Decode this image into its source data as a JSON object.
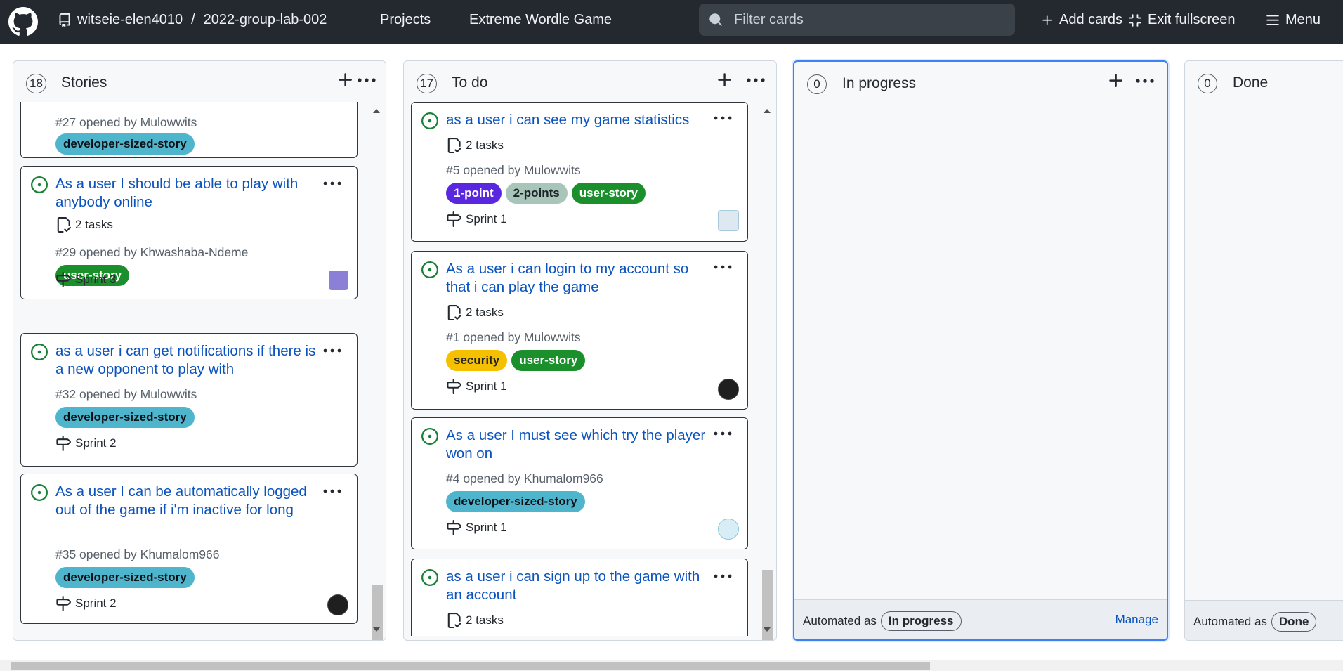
{
  "topbar": {
    "repo_owner": "witseie-elen4010",
    "repo_sep": "/",
    "repo_name": "2022-group-lab-002",
    "nav_projects": "Projects",
    "nav_project_name": "Extreme Wordle Game",
    "search_placeholder": "Filter cards",
    "add_cards": "Add cards",
    "exit_fullscreen": "Exit fullscreen",
    "menu": "Menu"
  },
  "colors": {
    "topbar_bg": "#24292f",
    "link_blue": "#0a53be",
    "open_green": "#1a7f37",
    "active_border": "#3b82f6"
  },
  "columns": [
    {
      "count": "18",
      "title": "Stories",
      "cards": [
        {
          "title": "",
          "meta": "#27 opened by Mulowwits",
          "labels": [
            {
              "text": "developer-sized-story",
              "bg": "#4eb5cc",
              "fg": "#0d1117"
            }
          ]
        },
        {
          "title": "As a user I should be able to play with anybody online",
          "tasks": "2 tasks",
          "meta": "#29 opened by Khwashaba-Ndeme",
          "labels": [
            {
              "text": "user-story",
              "bg": "#1a8f2c",
              "fg": "#ffffff"
            }
          ],
          "sprint": "Sprint 3"
        },
        {
          "title": "as a user i can get notifications if there is a new opponent to play with",
          "meta": "#32 opened by Mulowwits",
          "labels": [
            {
              "text": "developer-sized-story",
              "bg": "#4eb5cc",
              "fg": "#0d1117"
            }
          ],
          "sprint": "Sprint 2"
        },
        {
          "title": "As a user I can be automatically logged out of the game if i'm inactive for long",
          "meta": "#35 opened by Khumalom966",
          "labels": [
            {
              "text": "developer-sized-story",
              "bg": "#4eb5cc",
              "fg": "#0d1117"
            }
          ],
          "sprint": "Sprint 2"
        }
      ]
    },
    {
      "count": "17",
      "title": "To do",
      "cards": [
        {
          "title": "as a user i can see my game statistics",
          "tasks": "2 tasks",
          "meta": "#5 opened by Mulowwits",
          "labels": [
            {
              "text": "1-point",
              "bg": "#5a27e0",
              "fg": "#ffffff"
            },
            {
              "text": "2-points",
              "bg": "#a7c5b8",
              "fg": "#1f2328"
            },
            {
              "text": "user-story",
              "bg": "#1a8f2c",
              "fg": "#ffffff"
            }
          ],
          "sprint": "Sprint 1"
        },
        {
          "title": "As a user i can login to my account so that i can play the game",
          "tasks": "2 tasks",
          "meta": "#1 opened by Mulowwits",
          "labels": [
            {
              "text": "security",
              "bg": "#f5c000",
              "fg": "#1f2328"
            },
            {
              "text": "user-story",
              "bg": "#1a8f2c",
              "fg": "#ffffff"
            }
          ],
          "sprint": "Sprint 1"
        },
        {
          "title": "As a user I must see which try the player won on",
          "meta": "#4 opened by Khumalom966",
          "labels": [
            {
              "text": "developer-sized-story",
              "bg": "#4eb5cc",
              "fg": "#0d1117"
            }
          ],
          "sprint": "Sprint 1"
        },
        {
          "title": "as a user i can sign up to the game with an account",
          "tasks": "2 tasks"
        }
      ]
    },
    {
      "count": "0",
      "title": "In progress",
      "automated_label": "Automated as",
      "automated_value": "In progress",
      "manage": "Manage"
    },
    {
      "count": "0",
      "title": "Done",
      "automated_label": "Automated as",
      "automated_value": "Done"
    }
  ]
}
